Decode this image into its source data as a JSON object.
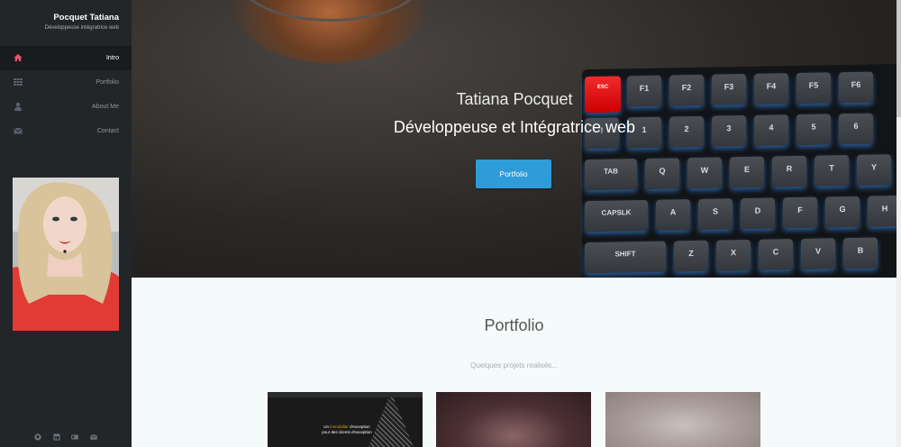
{
  "sidebar": {
    "brand_name": "Pocquet Tatiana",
    "brand_sub": "Développeuse intégratrice web",
    "items": [
      {
        "label": "Intro",
        "icon": "home-icon",
        "active": true
      },
      {
        "label": "Portfolio",
        "icon": "grid-icon",
        "active": false
      },
      {
        "label": "About Me",
        "icon": "user-icon",
        "active": false
      },
      {
        "label": "Contact",
        "icon": "envelope-icon",
        "active": false
      }
    ],
    "social_icons": [
      "github-icon",
      "linkedin-icon",
      "card-icon",
      "envelope-icon"
    ]
  },
  "hero": {
    "name": "Tatiana Pocquet",
    "role": "Développeuse et Intégratrice web",
    "button_label": "Portfolio",
    "keys_row1": [
      "ESC",
      "F1",
      "F2",
      "F3",
      "F4",
      "F5",
      "F6"
    ],
    "keys_row2": [
      "!",
      "1",
      "2",
      "3",
      "4",
      "5",
      "6"
    ],
    "keys_row3": [
      "TAB",
      "Q",
      "W",
      "E",
      "R",
      "T",
      "Y"
    ],
    "keys_row4": [
      "CAPSLK",
      "A",
      "S",
      "D",
      "F",
      "G",
      "H"
    ],
    "keys_row5": [
      "SHIFT",
      "Z",
      "X",
      "C",
      "V",
      "B"
    ]
  },
  "portfolio": {
    "title": "Portfolio",
    "subtitle": "Quelques projets realisés...",
    "thumb1_text_pre": "Un ",
    "thumb1_text_accent": "immobilier",
    "thumb1_text_post": " d'exception pour des clients d'exception"
  },
  "colors": {
    "sidebar_bg": "#222629",
    "accent_blue": "#2e9cd8",
    "active_icon": "#e8566c",
    "esc_key": "#e31b1b"
  }
}
